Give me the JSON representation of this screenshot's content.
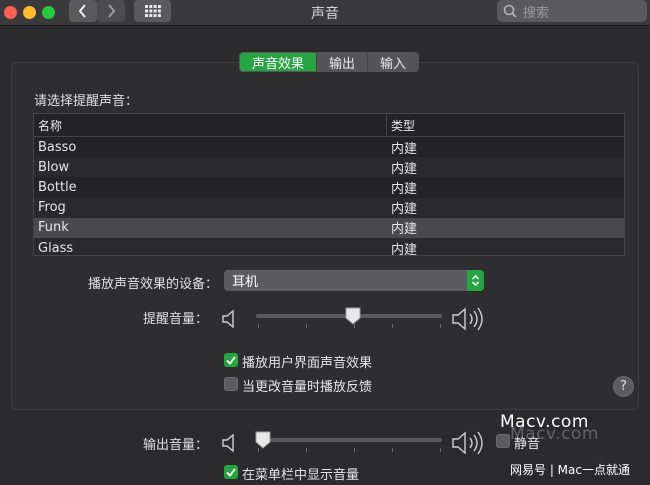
{
  "window": {
    "title": "声音"
  },
  "search": {
    "placeholder": "搜索"
  },
  "tabs": [
    {
      "label": "声音效果",
      "active": true
    },
    {
      "label": "输出",
      "active": false
    },
    {
      "label": "输入",
      "active": false
    }
  ],
  "sound_effects": {
    "prompt": "请选择提醒声音：",
    "columns": {
      "name": "名称",
      "type": "类型"
    },
    "rows": [
      {
        "name": "Basso",
        "type": "内建"
      },
      {
        "name": "Blow",
        "type": "内建"
      },
      {
        "name": "Bottle",
        "type": "内建"
      },
      {
        "name": "Frog",
        "type": "内建"
      },
      {
        "name": "Funk",
        "type": "内建",
        "selected": true
      },
      {
        "name": "Glass",
        "type": "内建"
      }
    ],
    "device_label": "播放声音效果的设备：",
    "device_value": "耳机",
    "alert_volume_label": "提醒音量：",
    "alert_volume_level": 0.52,
    "play_ui_label": "播放用户界面声音效果",
    "play_ui_checked": true,
    "feedback_label": "当更改音量时播放反馈",
    "feedback_checked": false
  },
  "output": {
    "volume_label": "输出音量：",
    "volume_level": 0.04,
    "mute_label": "静音",
    "mute_checked": false,
    "menubar_label": "在菜单栏中显示音量",
    "menubar_checked": true
  },
  "watermark": {
    "line1": "Macv.com",
    "line2": "Macv.com",
    "line3": "网易号 | Mac一点就通"
  },
  "colors": {
    "accent": "#27a543"
  },
  "help": {
    "label": "?"
  }
}
